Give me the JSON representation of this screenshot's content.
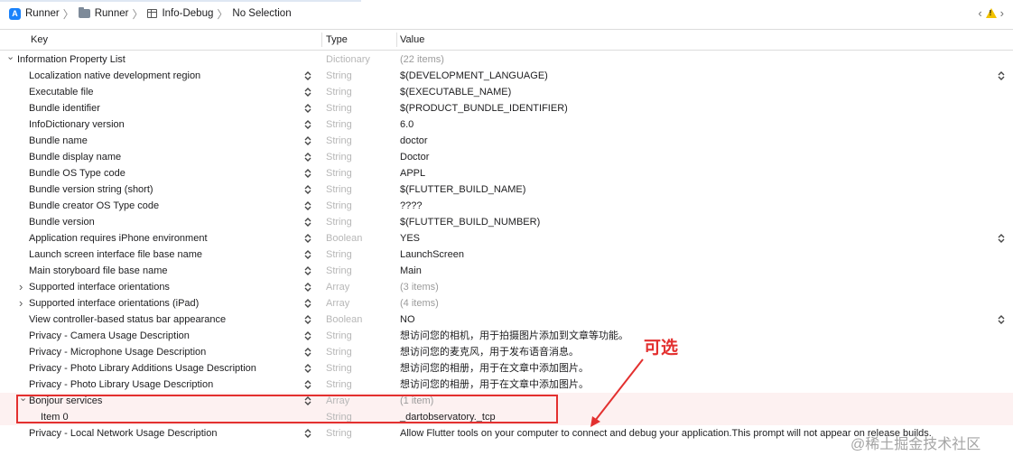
{
  "breadcrumbs": [
    {
      "label": "Runner",
      "icon": "app-icon"
    },
    {
      "label": "Runner",
      "icon": "folder-icon"
    },
    {
      "label": "Info-Debug",
      "icon": "plist-icon"
    },
    {
      "label": "No Selection",
      "icon": ""
    }
  ],
  "header": {
    "key": "Key",
    "type": "Type",
    "value": "Value"
  },
  "rows": [
    {
      "key": "Information Property List",
      "type": "Dictionary",
      "value": "(22 items)",
      "level": 0,
      "disclosure": "open",
      "dim": true
    },
    {
      "key": "Localization native development region",
      "type": "String",
      "value": "$(DEVELOPMENT_LANGUAGE)",
      "level": 1,
      "popup": true
    },
    {
      "key": "Executable file",
      "type": "String",
      "value": "$(EXECUTABLE_NAME)",
      "level": 1
    },
    {
      "key": "Bundle identifier",
      "type": "String",
      "value": "$(PRODUCT_BUNDLE_IDENTIFIER)",
      "level": 1
    },
    {
      "key": "InfoDictionary version",
      "type": "String",
      "value": "6.0",
      "level": 1
    },
    {
      "key": "Bundle name",
      "type": "String",
      "value": "doctor",
      "level": 1
    },
    {
      "key": "Bundle display name",
      "type": "String",
      "value": "Doctor",
      "level": 1
    },
    {
      "key": "Bundle OS Type code",
      "type": "String",
      "value": "APPL",
      "level": 1
    },
    {
      "key": "Bundle version string (short)",
      "type": "String",
      "value": "$(FLUTTER_BUILD_NAME)",
      "level": 1
    },
    {
      "key": "Bundle creator OS Type code",
      "type": "String",
      "value": "????",
      "level": 1
    },
    {
      "key": "Bundle version",
      "type": "String",
      "value": "$(FLUTTER_BUILD_NUMBER)",
      "level": 1
    },
    {
      "key": "Application requires iPhone environment",
      "type": "Boolean",
      "value": "YES",
      "level": 1,
      "popup": true
    },
    {
      "key": "Launch screen interface file base name",
      "type": "String",
      "value": "LaunchScreen",
      "level": 1
    },
    {
      "key": "Main storyboard file base name",
      "type": "String",
      "value": "Main",
      "level": 1
    },
    {
      "key": "Supported interface orientations",
      "type": "Array",
      "value": "(3 items)",
      "level": 1,
      "disclosure": "closed",
      "dim": true
    },
    {
      "key": "Supported interface orientations (iPad)",
      "type": "Array",
      "value": "(4 items)",
      "level": 1,
      "disclosure": "closed",
      "dim": true
    },
    {
      "key": "View controller-based status bar appearance",
      "type": "Boolean",
      "value": "NO",
      "level": 1,
      "popup": true
    },
    {
      "key": "Privacy - Camera Usage Description",
      "type": "String",
      "value": "想访问您的相机，用于拍摄图片添加到文章等功能。",
      "level": 1
    },
    {
      "key": "Privacy - Microphone Usage Description",
      "type": "String",
      "value": "想访问您的麦克风，用于发布语音消息。",
      "level": 1
    },
    {
      "key": "Privacy - Photo Library Additions Usage Description",
      "type": "String",
      "value": "想访问您的相册，用于在文章中添加图片。",
      "level": 1
    },
    {
      "key": "Privacy - Photo Library Usage Description",
      "type": "String",
      "value": "想访问您的相册，用于在文章中添加图片。",
      "level": 1
    },
    {
      "key": "Bonjour services",
      "type": "Array",
      "value": "(1 item)",
      "level": 1,
      "disclosure": "open",
      "dim": true
    },
    {
      "key": "Item 0",
      "type": "String",
      "value": "_dartobservatory._tcp",
      "level": 2,
      "nostepper": true
    },
    {
      "key": "Privacy - Local Network Usage Description",
      "type": "String",
      "value": "Allow Flutter tools on your computer to connect and debug your application.This prompt will not appear on release builds.",
      "level": 1
    }
  ],
  "annotation": {
    "label": "可选",
    "color": "#e3302f"
  },
  "watermark": "@稀土掘金技术社区"
}
